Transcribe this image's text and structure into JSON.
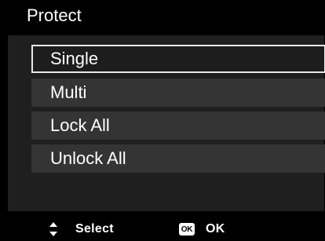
{
  "title": "Protect",
  "menu": {
    "items": [
      {
        "label": "Single",
        "selected": true
      },
      {
        "label": "Multi",
        "selected": false
      },
      {
        "label": "Lock All",
        "selected": false
      },
      {
        "label": "Unlock All",
        "selected": false
      }
    ]
  },
  "footer": {
    "nav_icon": "up-down-arrows-icon",
    "select_label": "Select",
    "ok_icon_text": "OK",
    "ok_label": "OK"
  },
  "colors": {
    "background": "#000000",
    "menu_panel": "#1f1f1f",
    "menu_item": "#343434",
    "selected_border": "#e8e8e8",
    "text": "#ffffff"
  }
}
